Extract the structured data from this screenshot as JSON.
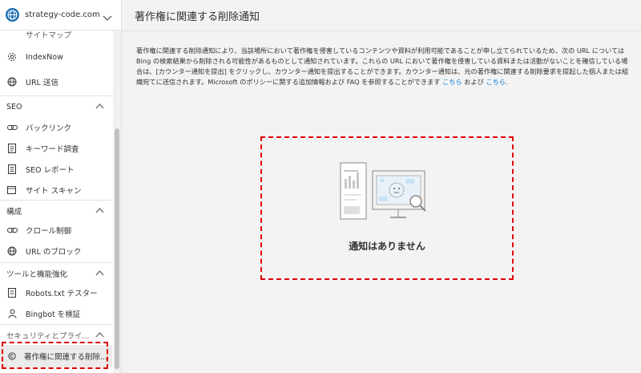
{
  "site": {
    "name": "strategy-code.com"
  },
  "sidebar": {
    "cut_item": "サイトマップ",
    "items_top": [
      {
        "label": "IndexNow",
        "icon": "gear-icon"
      },
      {
        "label": "URL 送信",
        "icon": "globe-icon"
      }
    ],
    "sections": [
      {
        "title": "SEO",
        "items": [
          {
            "label": "バックリンク",
            "icon": "link-icon"
          },
          {
            "label": "キーワード調査",
            "icon": "document-icon"
          },
          {
            "label": "SEO レポート",
            "icon": "report-icon"
          },
          {
            "label": "サイト スキャン",
            "icon": "scan-icon"
          }
        ]
      },
      {
        "title": "構成",
        "items": [
          {
            "label": "クロール制御",
            "icon": "link-icon"
          },
          {
            "label": "URL のブロック",
            "icon": "globe-icon"
          }
        ]
      },
      {
        "title": "ツールと機能強化",
        "items": [
          {
            "label": "Robots.txt テスター",
            "icon": "document-icon"
          },
          {
            "label": "Bingbot を検証",
            "icon": "person-icon"
          }
        ]
      },
      {
        "title": "セキュリティとプライ...",
        "items": [
          {
            "label": "著作権に関連する削除...",
            "icon": "copyright-icon"
          }
        ]
      }
    ]
  },
  "main": {
    "title": "著作権に関連する削除通知",
    "description_parts": {
      "body": "著作権に関連する削除通知により、当該場所において著作権を侵害しているコンテンツや資料が利用可能であることが申し立てられているため、次の URL については Bing の検索結果から削除される可能性があるものとして通知されています。これらの URL において著作権を侵害している資料または活動がないことを確信している場合は、[カウンター通知を提出] をクリックし、カウンター通知を提出することができます。カウンター通知は、元の著作権に関連する削除要求を提起した個人または組織宛てに送信されます。Microsoft のポリシーに関する追加情報および FAQ を参照することができます ",
      "link1": "こちら",
      "and": " および ",
      "link2": "こちら",
      "end": "."
    },
    "empty_message": "通知はありません"
  },
  "colors": {
    "accent": "#0078d4",
    "highlight_border": "#e00000",
    "brand_globe": "#1f6fb2"
  }
}
